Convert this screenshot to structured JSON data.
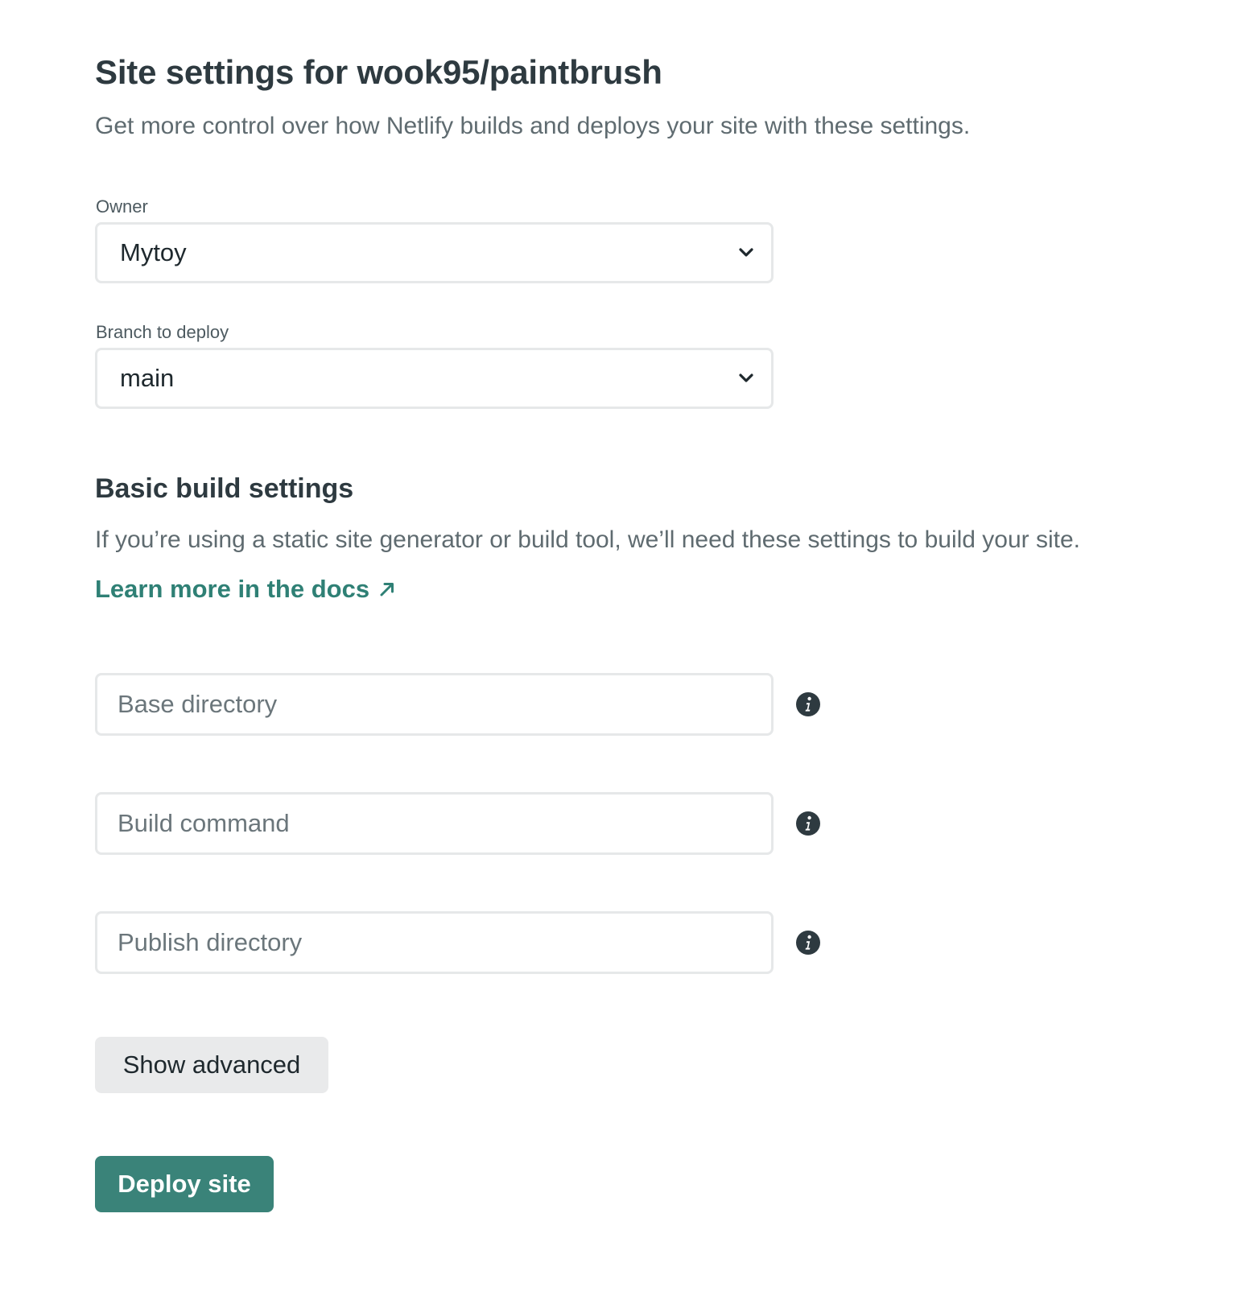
{
  "header": {
    "title": "Site settings for wook95/paintbrush",
    "subtitle": "Get more control over how Netlify builds and deploys your site with these settings."
  },
  "owner": {
    "label": "Owner",
    "value": "Mytoy"
  },
  "branch": {
    "label": "Branch to deploy",
    "value": "main"
  },
  "build_settings": {
    "title": "Basic build settings",
    "description": "If you’re using a static site generator or build tool, we’ll need these settings to build your site.",
    "docs_link": "Learn more in the docs",
    "base_directory": {
      "placeholder": "Base directory",
      "value": ""
    },
    "build_command": {
      "placeholder": "Build command",
      "value": ""
    },
    "publish_directory": {
      "placeholder": "Publish directory",
      "value": ""
    }
  },
  "actions": {
    "show_advanced_label": "Show advanced",
    "deploy_label": "Deploy site"
  },
  "icons": {
    "select_chevron": "chevron-down-icon",
    "external_link": "arrow-up-right-icon",
    "info": "info-icon"
  },
  "colors": {
    "text_primary": "#2e3a40",
    "text_secondary": "#5f6b70",
    "link": "#2f8075",
    "primary_button": "#3a8379",
    "secondary_button": "#e9eaeb",
    "input_border": "#e6e8e9"
  }
}
